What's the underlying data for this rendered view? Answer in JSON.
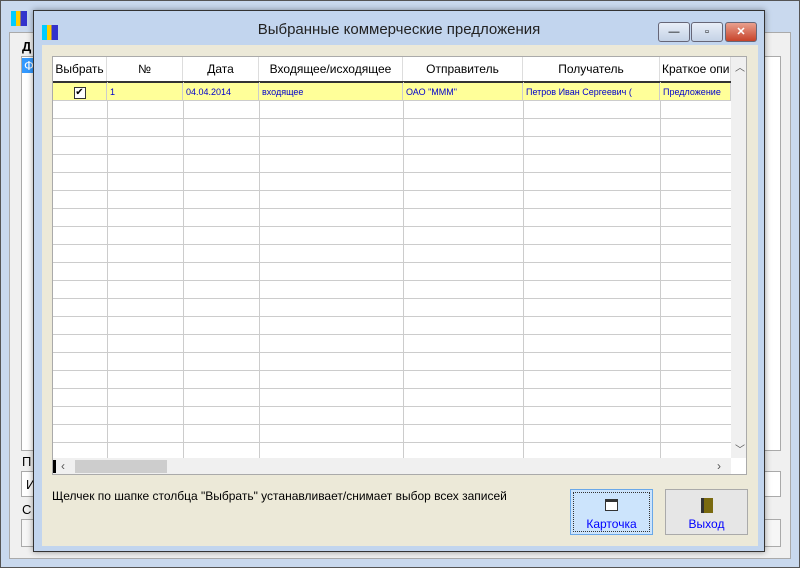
{
  "background_window": {
    "labels": [
      "Д",
      "Ф",
      "П",
      "И",
      "С"
    ]
  },
  "dialog": {
    "title": "Выбранные коммерческие предложения",
    "window_buttons": {
      "minimize": "—",
      "maximize": "▫",
      "close": "✕"
    },
    "table": {
      "columns": [
        "Выбрать",
        "№",
        "Дата",
        "Входящее/исходящее",
        "Отправитель",
        "Получатель",
        "Краткое опи"
      ],
      "rows": [
        {
          "checked": true,
          "check_mark": "✔",
          "num": "1",
          "date": "04.04.2014",
          "direction": "входящее",
          "sender": "ОАО \"МММ\"",
          "recipient": "Петров Иван Сергеевич (",
          "summary": "Предложение"
        }
      ],
      "highlight_color": "#ffff99"
    },
    "hint": "Щелчек по шапке столбца \"Выбрать\" устанавливает/снимает выбор всех записей",
    "buttons": {
      "card": "Карточка",
      "exit": "Выход"
    }
  }
}
